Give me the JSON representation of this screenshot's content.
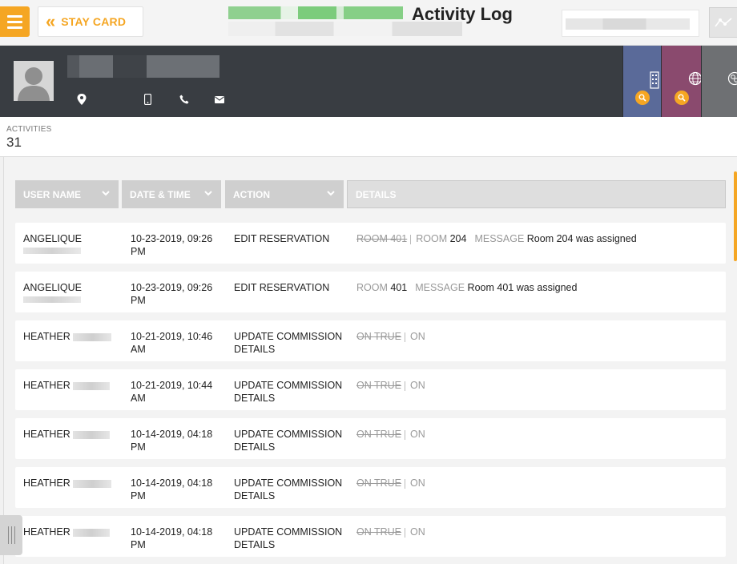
{
  "header": {
    "stay_card_label": "STAY CARD",
    "page_title": "Activity Log"
  },
  "guest": {
    "icons": [
      "location-pin-icon",
      "mobile-phone-icon",
      "phone-icon",
      "mail-icon"
    ],
    "tabs": [
      "building-icon",
      "globe-icon",
      "group-icon"
    ]
  },
  "activities": {
    "label": "ACTIVITIES",
    "count": "31"
  },
  "table": {
    "headers": [
      "USER NAME",
      "DATE & TIME",
      "ACTION",
      "DETAILS"
    ],
    "rows": [
      {
        "user": "ANGELIQUE",
        "date": "10-23-2019, 09:26",
        "time": "PM",
        "action": "EDIT RESERVATION",
        "old": "ROOM 401",
        "k1": "ROOM",
        "v1": "204",
        "k2": "MESSAGE",
        "v2": "Room 204 was assigned"
      },
      {
        "user": "ANGELIQUE",
        "date": "10-23-2019, 09:26",
        "time": "PM",
        "action": "EDIT RESERVATION",
        "k1": "ROOM",
        "v1": "401",
        "k2": "MESSAGE",
        "v2": "Room 401 was assigned"
      },
      {
        "user": "HEATHER",
        "date": "10-21-2019, 10:46",
        "time": "AM",
        "action": "UPDATE COMMISSION",
        "action2": "DETAILS",
        "old": "ON TRUE",
        "k1": "ON"
      },
      {
        "user": "HEATHER",
        "date": "10-21-2019, 10:44",
        "time": "AM",
        "action": "UPDATE COMMISSION",
        "action2": "DETAILS",
        "old": "ON TRUE",
        "k1": "ON"
      },
      {
        "user": "HEATHER",
        "date": "10-14-2019, 04:18",
        "time": "PM",
        "action": "UPDATE COMMISSION",
        "action2": "DETAILS",
        "old": "ON TRUE",
        "k1": "ON"
      },
      {
        "user": "HEATHER",
        "date": "10-14-2019, 04:18",
        "time": "PM",
        "action": "UPDATE COMMISSION",
        "action2": "DETAILS",
        "old": "ON TRUE",
        "k1": "ON"
      },
      {
        "user": "HEATHER",
        "date": "10-14-2019, 04:18",
        "time": "PM",
        "action": "UPDATE COMMISSION",
        "action2": "DETAILS",
        "old": "ON TRUE",
        "k1": "ON"
      }
    ]
  },
  "colors": {
    "accent": "#f5a623",
    "guest_bar": "#393d42",
    "header_cell": "#cfcfcf"
  }
}
